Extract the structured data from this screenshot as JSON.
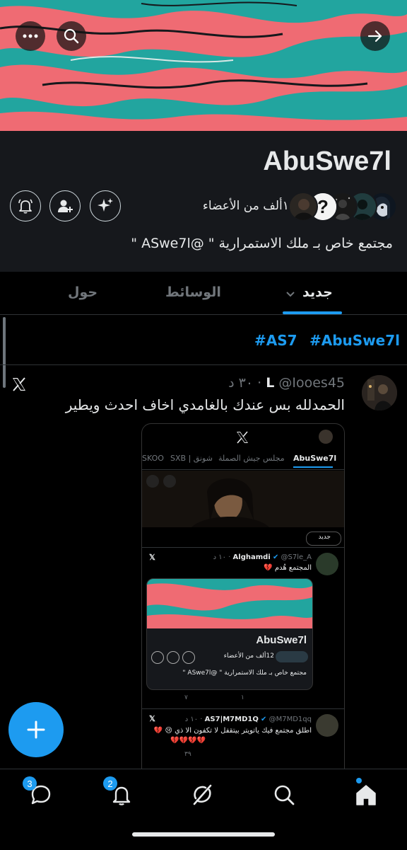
{
  "header": {
    "community_name": "AbuSwe7l",
    "members_text": "١٢ألف من الأعضاء",
    "description": "مجتمع خاص بـ ملك الاستمرارية \" @ASwe7l \""
  },
  "tabs": [
    {
      "label": "جديد",
      "active": true
    },
    {
      "label": "الوسائط",
      "active": false
    },
    {
      "label": "حول",
      "active": false
    }
  ],
  "hashtags": [
    "#AbuSwe7l",
    "#AS7"
  ],
  "post": {
    "author": "L",
    "handle": "@Iooes45",
    "time": "٣٠ د",
    "text": "الحمدلله بس عندك بالغامدي اخاف احدث ويطير",
    "media": {
      "tabs": [
        "AbuSwe7l",
        "مجلس جيش الصملة",
        "شونق | SXB",
        "SKOO"
      ],
      "sort_label": "جديد",
      "tweet1": {
        "name": "Alghamdi",
        "handle": "@S7le_A",
        "time": "١٠ د",
        "text": "المجتمع هُدم 💔"
      },
      "inner_name": "AbuSwe7l",
      "inner_members": "12ألف من الأعضاء",
      "inner_desc": "مجتمع خاص بـ ملك الاستمرارية \" @ASwe7l \"",
      "stats1": {
        "replies": "١",
        "views": "٧"
      },
      "tweet2": {
        "name": "AS7|M7MD1Q",
        "handle": "@M7MD1qq",
        "time": "١٠ د",
        "text": "اطلق مجتمع فيك ياتويتر بيتقفل لا تكفون الا ذي 😢 💔",
        "hearts": "💔💔💔💔"
      },
      "stats2": {
        "views": "٣٩"
      }
    }
  },
  "bottom_nav": {
    "messages_badge": "3",
    "notifications_badge": "2"
  },
  "colors": {
    "accent": "#1d9bf0",
    "header_bg": "#16181c",
    "banner_coral": "#ef6b73",
    "banner_teal": "#22a59f"
  }
}
